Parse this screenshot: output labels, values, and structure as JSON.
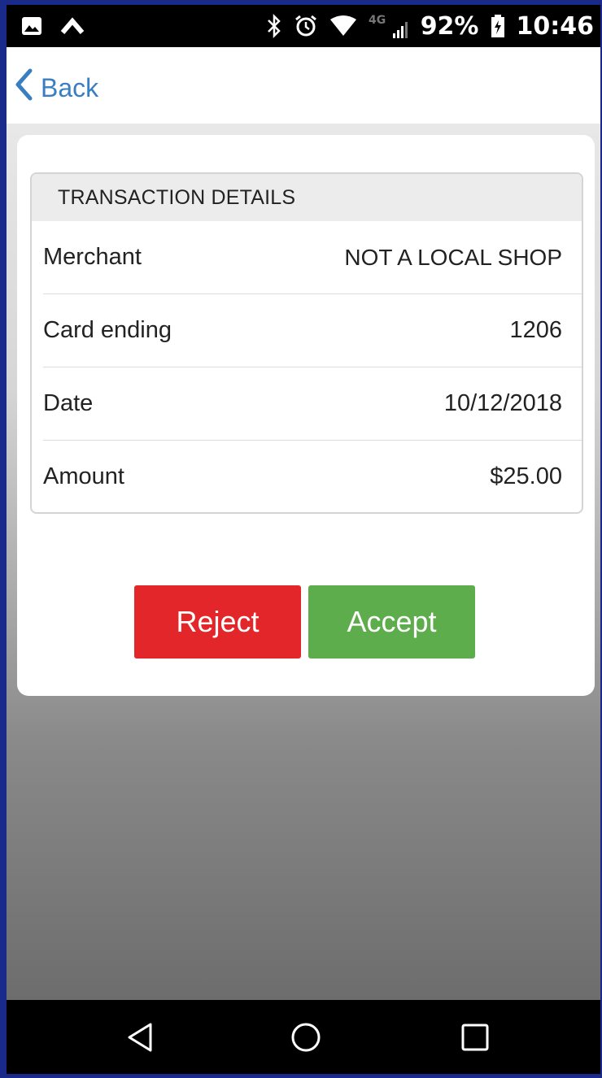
{
  "status_bar": {
    "battery": "92%",
    "time": "10:46",
    "network": "4G",
    "icons": [
      "image-icon",
      "chevron-up-icon",
      "bluetooth-icon",
      "alarm-icon",
      "wifi-icon",
      "signal-icon",
      "battery-charging-icon"
    ]
  },
  "header": {
    "back_label": "Back"
  },
  "details": {
    "title": "TRANSACTION DETAILS",
    "rows": [
      {
        "label": "Merchant",
        "value": "NOT A LOCAL SHOP"
      },
      {
        "label": "Card ending",
        "value": "1206"
      },
      {
        "label": "Date",
        "value": "10/12/2018"
      },
      {
        "label": "Amount",
        "value": "$25.00"
      }
    ]
  },
  "actions": {
    "reject_label": "Reject",
    "accept_label": "Accept",
    "reject_color": "#e3262a",
    "accept_color": "#5ead4c"
  },
  "nav": {
    "icons": [
      "nav-back-icon",
      "nav-home-icon",
      "nav-recents-icon"
    ]
  },
  "colors": {
    "link": "#3a7ec2"
  }
}
